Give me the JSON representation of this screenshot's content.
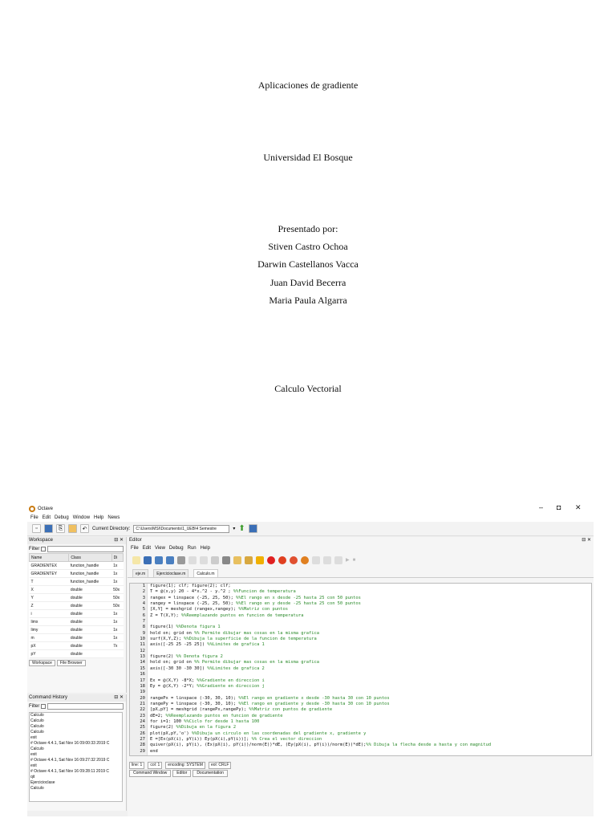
{
  "document": {
    "title": "Aplicaciones de gradiente",
    "university": "Universidad El Bosque",
    "presented_by": "Presentado por:",
    "authors": [
      "Stiven Castro Ochoa",
      "Darwin Castellanos Vacca",
      "Juan David Becerra",
      "Maria Paula Algarra"
    ],
    "course": "Calculo Vectorial"
  },
  "octave": {
    "window_title": "Octave",
    "controls": {
      "minimize": "–",
      "maximize": "◘",
      "close": "✕"
    },
    "menu": [
      "File",
      "Edit",
      "Debug",
      "Window",
      "Help",
      "News"
    ],
    "current_directory_label": "Current Directory:",
    "current_directory": "C:\\Users\\MSI\\Documents\\1_UEB\\4 Semestre",
    "workspace": {
      "title": "Workspace",
      "filter_label": "Filter",
      "columns": [
        "Name",
        "Class",
        "Di"
      ],
      "rows": [
        [
          "GRADIENTEX",
          "function_handle",
          "1x"
        ],
        [
          "GRADIENTEY",
          "function_handle",
          "1x"
        ],
        [
          "T",
          "function_handle",
          "1x"
        ],
        [
          "X",
          "double",
          "50x"
        ],
        [
          "Y",
          "double",
          "50x"
        ],
        [
          "Z",
          "double",
          "50x"
        ],
        [
          "i",
          "double",
          "1x"
        ],
        [
          "limx",
          "double",
          "1x"
        ],
        [
          "limy",
          "double",
          "1x"
        ],
        [
          "m",
          "double",
          "1x"
        ],
        [
          "pX",
          "double",
          "7x"
        ],
        [
          "pY",
          "double",
          ""
        ]
      ],
      "tabs": [
        "Workspace",
        "File Browser"
      ]
    },
    "command_history": {
      "title": "Command History",
      "filter_label": "Filter",
      "items": [
        "Calculo",
        "Calculo",
        "Calculo",
        "Calculo",
        "exit",
        "# Octave 4.4.1, Sat Nov 16 09:00:33 2019 C",
        "Calculo",
        "exit",
        "# Octave 4.4.1, Sat Nov 16 09:27:32 2019 C",
        "exit",
        "# Octave 4.4.1, Sat Nov 16 09:28:11 2019 C",
        "qit",
        "Ejercicioclase",
        "Calculo"
      ]
    },
    "editor": {
      "title": "Editor",
      "menu": [
        "File",
        "Edit",
        "View",
        "Debug",
        "Run",
        "Help"
      ],
      "tabs": [
        "eje.m",
        "Ejercicioclase.m",
        "Calculo.m"
      ],
      "line_numbers": [
        "1",
        "2",
        "3",
        "4",
        "5",
        "6",
        "7",
        "8",
        "9",
        "10",
        "11",
        "12",
        "13",
        "14",
        "15",
        "16",
        "17",
        "18",
        "19",
        "20",
        "21",
        "22",
        "23",
        "24",
        "25",
        "26",
        "27",
        "28",
        "29"
      ],
      "code": [
        {
          "c": "figure(1); clf; figure(2); clf;",
          "k": ""
        },
        {
          "c": "T = @(x,y) 20 - 4*x.^2 - y.^2 ; ",
          "k": "%%Funcion de temperatura"
        },
        {
          "c": "rangex = linspace (-25, 25, 50); ",
          "k": "%%El rango en x desde -25 hasta 25 con 50 puntos"
        },
        {
          "c": "rangey = linspace (-25, 25, 50); ",
          "k": "%%El rango en y desde -25 hasta 25 con 50 puntos"
        },
        {
          "c": "[X,Y] = meshgrid (rangex,rangey); ",
          "k": "%%Matriz con puntos"
        },
        {
          "c": "Z = T(X,Y); ",
          "k": "%%Reemplazando puntos en funcion de temperatura"
        },
        {
          "c": "",
          "k": ""
        },
        {
          "c": "figure(1) ",
          "k": "%%Denota figura 1"
        },
        {
          "c": "hold on; grid on ",
          "k": "%% Permite dibujar mas cosas en la misma grafica"
        },
        {
          "c": "surf(X,Y,Z); ",
          "k": "%%Dibuja la superficie de la funcion de temperatura"
        },
        {
          "c": "axis([-25 25 -25 25]) ",
          "k": "%%Limites de grafica 1"
        },
        {
          "c": "",
          "k": ""
        },
        {
          "c": "figure(2) ",
          "k": "%% Denota figura 2"
        },
        {
          "c": "hold on; grid on ",
          "k": "%% Permite dibujar mas cosas en la misma grafica"
        },
        {
          "c": "axis([-30 30 -30 30]) ",
          "k": "%%Limites de grafica 2"
        },
        {
          "c": "",
          "k": ""
        },
        {
          "c": "Ex = @(X,Y) -8*X; ",
          "k": "%%Gradiente en direccion i"
        },
        {
          "c": "Ey = @(X,Y) -2*Y; ",
          "k": "%%Gradiente en direccion j"
        },
        {
          "c": "",
          "k": ""
        },
        {
          "c": "rangePx = linspace (-30, 30, 10); ",
          "k": "%%El rango en gradiente x desde -30 hasta 30 con 10 puntos"
        },
        {
          "c": "rangePy = linspace (-30, 30, 10); ",
          "k": "%%El rango en gradiente y desde -30 hasta 30 con 10 puntos"
        },
        {
          "c": "[pX,pY] = meshgrid (rangePx,rangePy); ",
          "k": "%%Matriz con puntos de gradiente"
        },
        {
          "c": "dE=2; ",
          "k": "%%Reemplazando puntos en funcion de gradiente"
        },
        {
          "c": "for i=1: 100 ",
          "k": "%%Ciclo for desde 1 hasta 100"
        },
        {
          "c": "figure(2) ",
          "k": "%%Dibuja en la figura 2"
        },
        {
          "c": "plot(pX,pY,'o') ",
          "k": "%%Dibuja un circulo en las coordenadas del gradiente x, gradiente y"
        },
        {
          "c": "E =[Ex(pX(i), pY(i)) Ey(pX(i),pY(i))]; ",
          "k": "%% Crea el vector direccion"
        },
        {
          "c": "quiver(pX(i), pY(i), (Ex(pX(i), pY(i))/norm(E))*dE, (Ey(pX(i), pY(i))/norm(E))*dE);",
          "k": "%% Dibuja la flecha desde a hasta y con magnitud"
        },
        {
          "c": "end",
          "k": ""
        }
      ],
      "status": [
        "line: 1",
        "col: 1",
        "encoding: SYSTEM",
        "eol: CRLF"
      ]
    },
    "bottom_tabs": [
      "Command Window",
      "Editor",
      "Documentation"
    ]
  }
}
